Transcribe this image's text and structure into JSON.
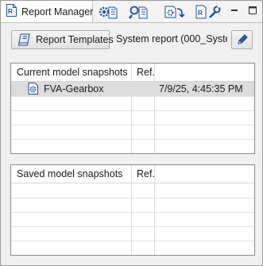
{
  "tab": {
    "title": "Report Manager"
  },
  "toolbar_icons": [
    "gear-report-icon",
    "search-report-icon",
    "export-report-icon",
    "report-settings-icon"
  ],
  "window_controls": [
    "minimize-icon",
    "maximize-icon"
  ],
  "actions": {
    "report_templates_label": "Report Templates",
    "system_report_text": "System report (000_System",
    "edit_icon": "pencil-icon"
  },
  "current_table": {
    "columns": [
      "Current model snapshots",
      "Ref."
    ],
    "rows": [
      {
        "name": "FVA-Gearbox",
        "ref": "",
        "date": "7/9/25, 4:45:35 PM",
        "selected": true
      }
    ]
  },
  "saved_table": {
    "columns": [
      "Saved model snapshots",
      "Ref."
    ],
    "rows": []
  },
  "colors": {
    "selection": "#dcdcdc",
    "icon_blue": "#1f4e99"
  }
}
